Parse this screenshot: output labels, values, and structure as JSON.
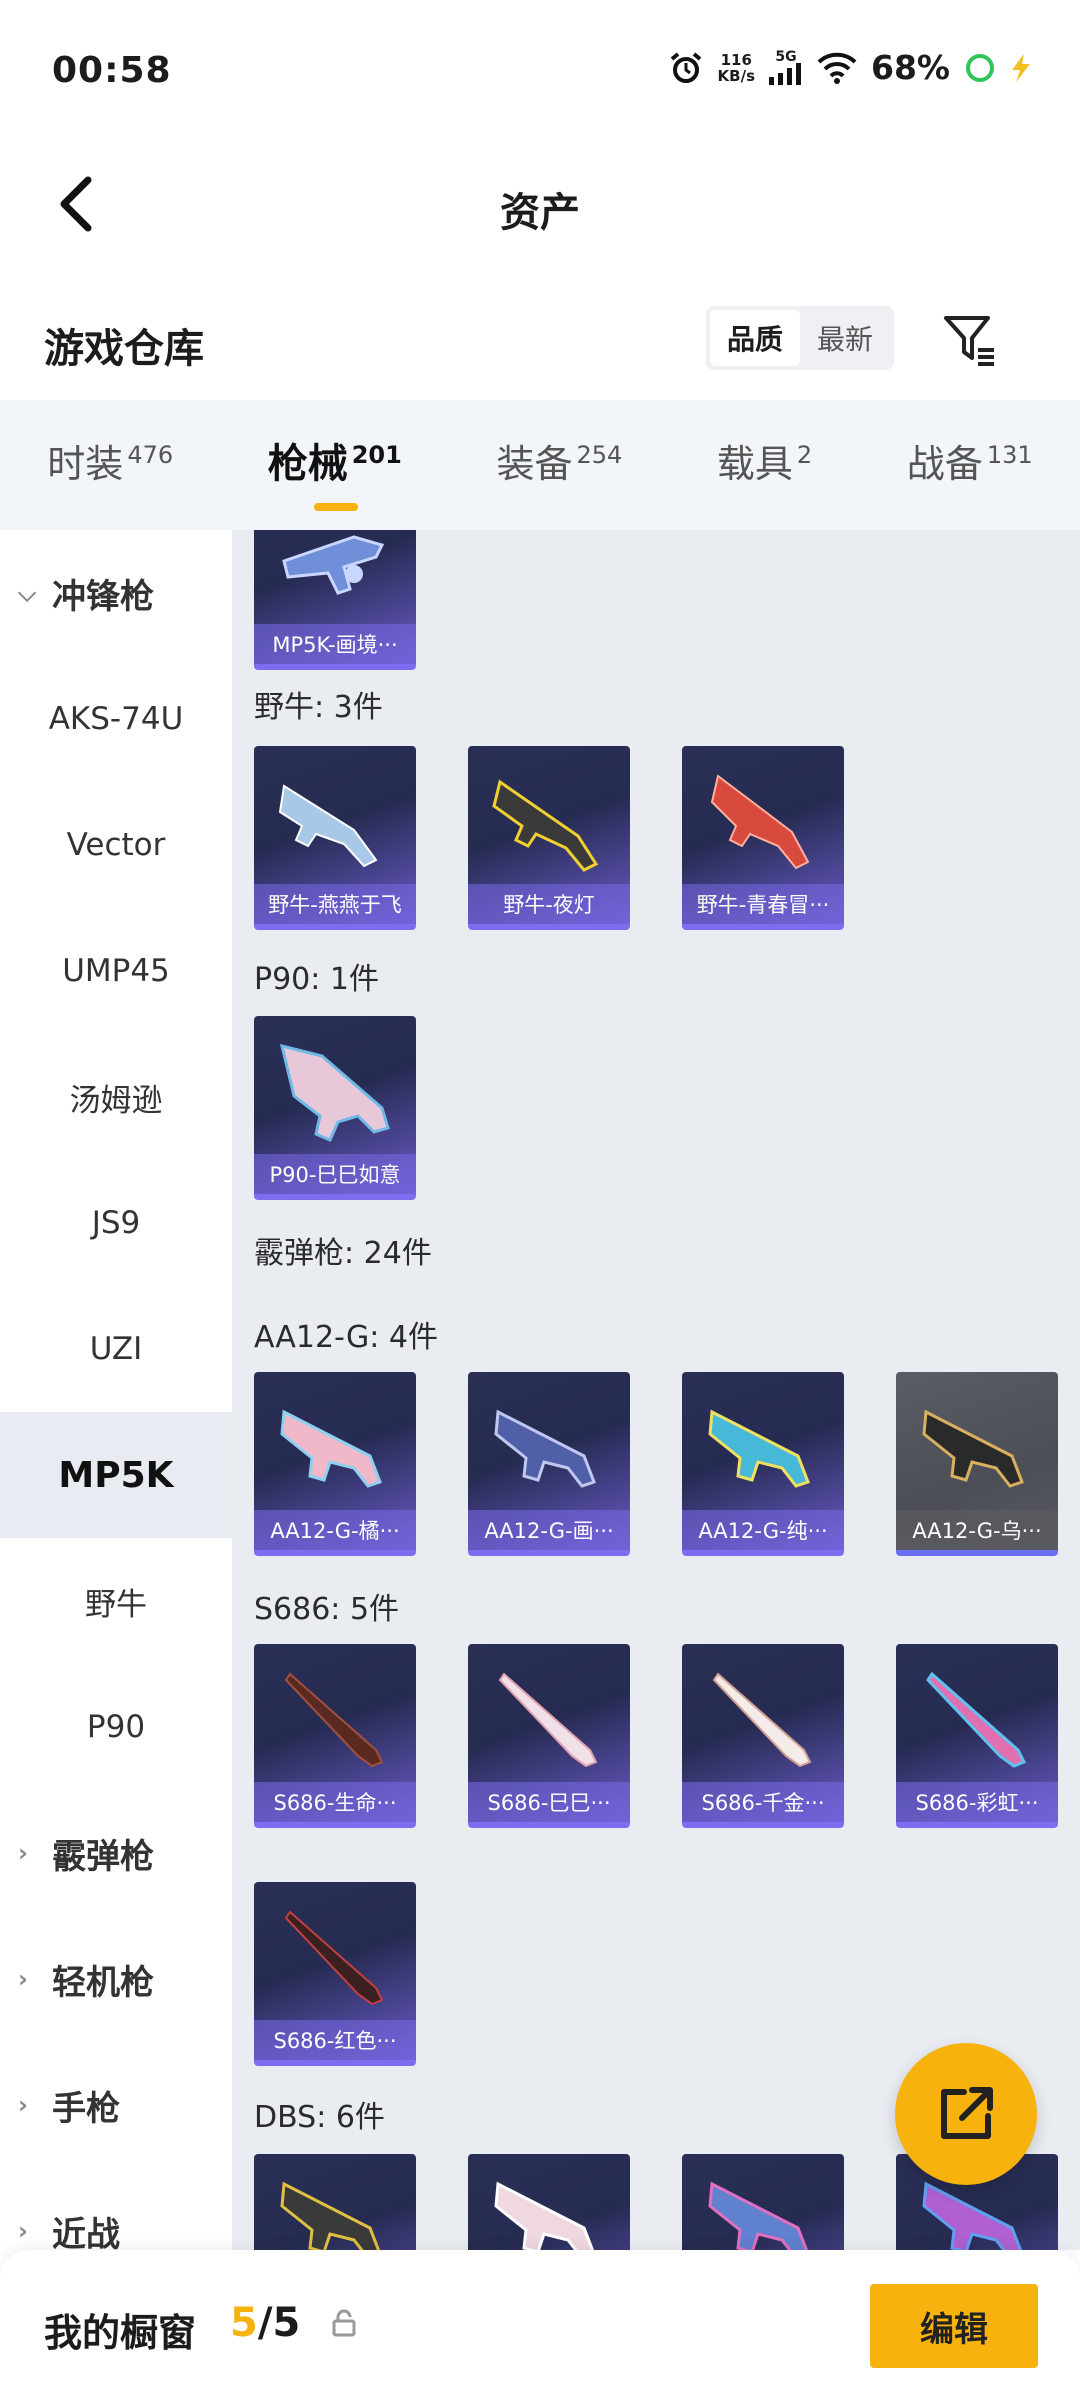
{
  "status_bar": {
    "time": "00:58",
    "net_speed_top": "116",
    "net_speed_bottom": "KB/s",
    "network_type": "5G",
    "battery": "68%"
  },
  "header": {
    "title": "资产"
  },
  "subheader": {
    "title": "游戏仓库",
    "sort_options": [
      "品质",
      "最新"
    ],
    "sort_selected": "品质"
  },
  "tabs": [
    {
      "label": "时装",
      "count": "476"
    },
    {
      "label": "枪械",
      "count": "201"
    },
    {
      "label": "装备",
      "count": "254"
    },
    {
      "label": "载具",
      "count": "2"
    },
    {
      "label": "战备",
      "count": "131"
    }
  ],
  "sidebar": {
    "items": [
      {
        "label": "冲锋枪",
        "caret": "⌵"
      },
      {
        "label": "AKS-74U"
      },
      {
        "label": "Vector"
      },
      {
        "label": "UMP45"
      },
      {
        "label": "汤姆逊"
      },
      {
        "label": "JS9"
      },
      {
        "label": "UZI"
      },
      {
        "label": "MP5K"
      },
      {
        "label": "野牛"
      },
      {
        "label": "P90"
      },
      {
        "label": "霰弹枪",
        "caret": "›"
      },
      {
        "label": "轻机枪",
        "caret": "›"
      },
      {
        "label": "手枪",
        "caret": "›"
      },
      {
        "label": "近战",
        "caret": "›"
      }
    ]
  },
  "groups": {
    "bison": "野牛: 3件",
    "p90": "P90: 1件",
    "shotgun": "霰弹枪: 24件",
    "aa12": "AA12-G: 4件",
    "s686": "S686: 5件",
    "dbs": "DBS: 6件"
  },
  "cards": {
    "mp5k": [
      "MP5K-画境···"
    ],
    "bison": [
      "野牛-燕燕于飞",
      "野牛-夜灯",
      "野牛-青春冒···"
    ],
    "p90": [
      "P90-巳巳如意"
    ],
    "aa12": [
      "AA12-G-橘···",
      "AA12-G-画···",
      "AA12-G-纯···",
      "AA12-G-乌···"
    ],
    "s686": [
      "S686-生命···",
      "S686-巳巳···",
      "S686-千金···",
      "S686-彩虹···",
      "S686-红色···"
    ],
    "dbs": [
      "",
      "",
      "",
      ""
    ]
  },
  "footer": {
    "title": "我的橱窗",
    "count_current": "5",
    "count_sep_total": "/5",
    "edit_label": "编辑"
  },
  "colors": {
    "accent": "#f7b20e",
    "card_purple": "#6a5bc9"
  }
}
